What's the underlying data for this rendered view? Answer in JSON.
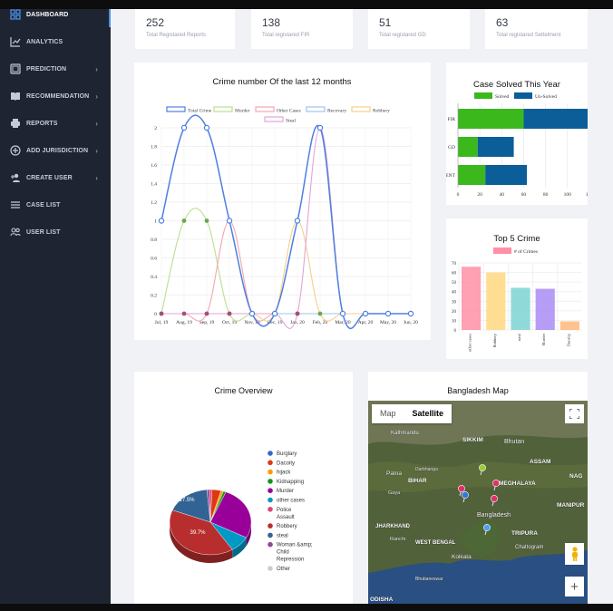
{
  "sidebar": {
    "items": [
      {
        "label": "DASHBOARD",
        "icon": "dashboard-icon",
        "active": true,
        "chevron": false
      },
      {
        "label": "ANALYTICS",
        "icon": "analytics-icon",
        "chevron": false
      },
      {
        "label": "PREDICTION",
        "icon": "prediction-icon",
        "chevron": true
      },
      {
        "label": "RECOMMENDATION",
        "icon": "recommendation-icon",
        "chevron": true
      },
      {
        "label": "REPORTS",
        "icon": "print-icon",
        "chevron": true
      },
      {
        "label": "ADD JURISDICTION",
        "icon": "add-circle-icon",
        "chevron": true
      },
      {
        "label": "CREATE USER",
        "icon": "add-user-icon",
        "chevron": true
      },
      {
        "label": "CASE LIST",
        "icon": "list-icon",
        "chevron": false
      },
      {
        "label": "USER LIST",
        "icon": "users-icon",
        "chevron": false
      }
    ],
    "accent": "#4a90e2"
  },
  "stats": [
    {
      "value": "252",
      "label": "Total Registared Reports"
    },
    {
      "value": "138",
      "label": "Total registared FIR"
    },
    {
      "value": "51",
      "label": "Total registared GD"
    },
    {
      "value": "63",
      "label": "Total registared Settelment"
    }
  ],
  "cards": {
    "crime_overview_title": "Crime Overview",
    "map_title": "Bangladesh Map"
  },
  "map": {
    "map_tab": "Map",
    "satellite_tab": "Satellite",
    "zoom_in": "+",
    "labels": [
      "Kathmandu",
      "SIKKIM",
      "Bhutan",
      "ASSAM",
      "NAG",
      "Patna",
      "Darbhanga",
      "BIHAR",
      "MEGHALAYA",
      "Gaya",
      "MANIPUR",
      "Bangladesh",
      "JHARKHAND",
      "TRIPURA",
      "Ranchi",
      "WEST BENGAL",
      "Chattogram",
      "Kolkata",
      "ODISHA",
      "Bhubaneswar"
    ]
  },
  "chart_data": [
    {
      "type": "line",
      "title": "Crime number Of the last 12 months",
      "x": [
        "Jul, 19",
        "Aug, 19",
        "Sep, 19",
        "Oct, 19",
        "Nov, 19",
        "Dec, 19",
        "Jan, 20",
        "Feb, 20",
        "Mar, 20",
        "Apr, 20",
        "May, 20",
        "Jun, 20"
      ],
      "ylim": [
        0,
        2
      ],
      "yticks": [
        "0",
        "0.2",
        "0.4",
        "0.6",
        "0.8",
        "1",
        "1.2",
        "1.4",
        "1.6",
        "1.8",
        "2"
      ],
      "series": [
        {
          "name": "Total Crime",
          "color": "#4f7fe0",
          "values": [
            1,
            2,
            2,
            1,
            0,
            0,
            1,
            2,
            0,
            0,
            0,
            0
          ]
        },
        {
          "name": "Murder",
          "color": "#b9e08e",
          "values": [
            0,
            1,
            1,
            0,
            0,
            0,
            0,
            0,
            0,
            0,
            0,
            0
          ]
        },
        {
          "name": "Other Cases",
          "color": "#f4a6b0",
          "values": [
            0,
            0,
            0,
            1,
            0,
            0,
            0,
            0,
            0,
            0,
            0,
            0
          ]
        },
        {
          "name": "Recovary",
          "color": "#9ec5ee",
          "values": [
            0,
            0,
            0,
            0,
            0,
            0,
            0,
            0,
            0,
            0,
            0,
            0
          ]
        },
        {
          "name": "Robbery",
          "color": "#f5cf8a",
          "values": [
            0,
            0,
            0,
            0,
            0,
            0,
            1,
            0,
            0,
            0,
            0,
            0
          ]
        },
        {
          "name": "Steal",
          "color": "#e3a3d8",
          "values": [
            0,
            0,
            0,
            0,
            0,
            0,
            0,
            2,
            0,
            0,
            0,
            0
          ]
        }
      ],
      "grid": true,
      "legend": "top"
    },
    {
      "type": "bar",
      "title": "Case Solved This Year",
      "orientation": "horizontal",
      "stacked": true,
      "categories": [
        "FIR",
        "GD",
        "SETTELMENT"
      ],
      "series": [
        {
          "name": "Solved",
          "color": "#3bb81c",
          "values": [
            60,
            18,
            25
          ]
        },
        {
          "name": "Un-Solved",
          "color": "#0b5e98",
          "values": [
            78,
            33,
            38
          ]
        }
      ],
      "xticks": [
        "0",
        "20",
        "40",
        "60",
        "80",
        "100",
        "120",
        "140"
      ],
      "xlim": [
        0,
        140
      ],
      "legend": "top"
    },
    {
      "type": "bar",
      "title": "Top 5 Crime",
      "categories": [
        "other cases",
        "Robbery",
        "steal",
        "Murder",
        "Dacoity"
      ],
      "series": [
        {
          "name": "# of Crimes",
          "values": [
            66,
            60,
            44,
            43,
            9
          ]
        }
      ],
      "colors": [
        "#ff8fa6",
        "#ffd77f",
        "#7dd3d3",
        "#a98cf4",
        "#ffb77a"
      ],
      "ylim": [
        0,
        70
      ],
      "yticks": [
        "0",
        "10",
        "20",
        "30",
        "40",
        "50",
        "60",
        "70"
      ],
      "legend": "top"
    },
    {
      "type": "pie",
      "title": "Crime Overview",
      "legend": "right",
      "slices": [
        {
          "label": "Burglary",
          "color": "#36c",
          "value": null
        },
        {
          "label": "Dacoity",
          "color": "#dc3912",
          "value": 3.5
        },
        {
          "label": "hijack",
          "color": "#f90",
          "value": 1.0
        },
        {
          "label": "Kidnapping",
          "color": "#109618",
          "value": 1.0
        },
        {
          "label": "Murder",
          "color": "#990099",
          "value": 26.4
        },
        {
          "label": "other cases",
          "color": "#0099c6",
          "value": 8.0
        },
        {
          "label": "Police Assault",
          "color": "#dd4477",
          "value": 1.0
        },
        {
          "label": "Robbery",
          "color": "#b82e2e",
          "value": 39.7
        },
        {
          "label": "steal",
          "color": "#316395",
          "value": 17.5
        },
        {
          "label": "Woman &amp; Child Repression",
          "color": "#994499",
          "value": 1.0
        },
        {
          "label": "Other",
          "color": "#cccccc",
          "value": null
        }
      ],
      "data_labels": [
        "17.5%",
        "26.4%",
        "39.7%"
      ]
    }
  ]
}
